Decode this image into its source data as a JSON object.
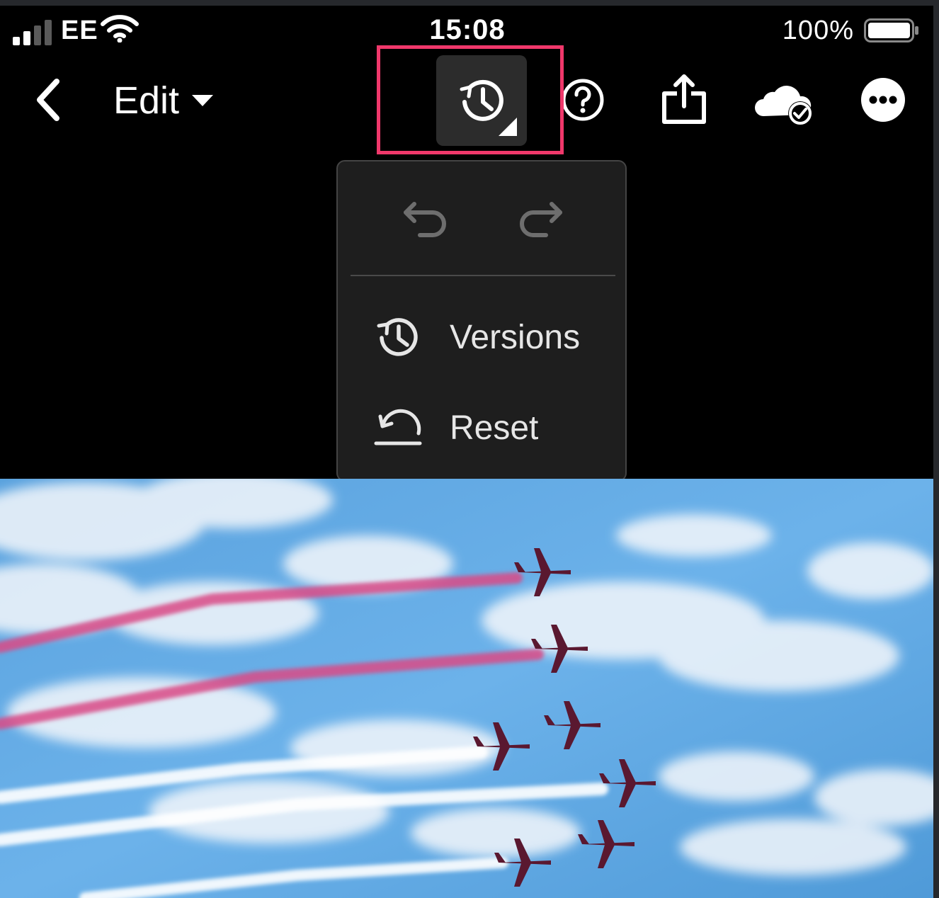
{
  "status_bar": {
    "carrier": "EE",
    "time": "15:08",
    "battery_percent": "100%",
    "signal_bars_filled": 2,
    "signal_bars_total": 4
  },
  "toolbar": {
    "back_icon": "chevron-left-icon",
    "edit_label": "Edit",
    "history_icon": "history-icon",
    "help_icon": "help-circle-icon",
    "share_icon": "share-icon",
    "cloud_icon": "cloud-synced-icon",
    "more_icon": "more-circle-icon"
  },
  "history_menu": {
    "undo_icon": "undo-icon",
    "redo_icon": "redo-icon",
    "items": [
      {
        "label": "Versions",
        "icon": "versions-history-icon"
      },
      {
        "label": "Reset",
        "icon": "reset-icon"
      }
    ]
  },
  "colors": {
    "highlight": "#f0386b",
    "popover_bg": "#1e1e1e",
    "sky": "#6aaee6",
    "smoke_red": "#d94a86"
  }
}
